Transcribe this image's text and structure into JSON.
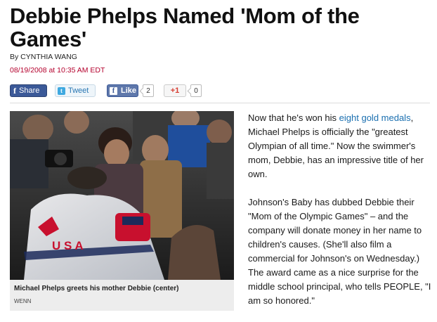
{
  "article": {
    "headline": "Debbie Phelps Named 'Mom of the Games'",
    "byline": "By CYNTHIA WANG",
    "dateline": "08/19/2008 at 10:35 AM EDT"
  },
  "share": {
    "facebook_share_label": "Share",
    "tweet_label": "Tweet",
    "like_label": "Like",
    "like_count": "2",
    "gplus_label": "+1",
    "gplus_count": "0"
  },
  "photo": {
    "caption": "Michael Phelps greets his mother Debbie (center)",
    "credit": "WENN",
    "jacket_letters": "U S A"
  },
  "body": {
    "p1_before_link": "Now that he's won his ",
    "p1_link": "eight gold medals",
    "p1_after_link": ", Michael Phelps is officially the \"greatest Olympian of all time.\" Now the swimmer's mom, Debbie, has an impressive title of her own.",
    "p2": "Johnson's Baby has dubbed Debbie their \"Mom of the Olympic Games\" – and the company will donate money in her name to children's causes. (She'll also film a commercial for Johnson's on Wednesday.) The award came as a nice surprise for the middle school principal, who tells PEOPLE, \"I am so honored.\""
  },
  "colors": {
    "dateline": "#b4002d",
    "link": "#1a6fb0",
    "facebook": "#3b5998"
  }
}
